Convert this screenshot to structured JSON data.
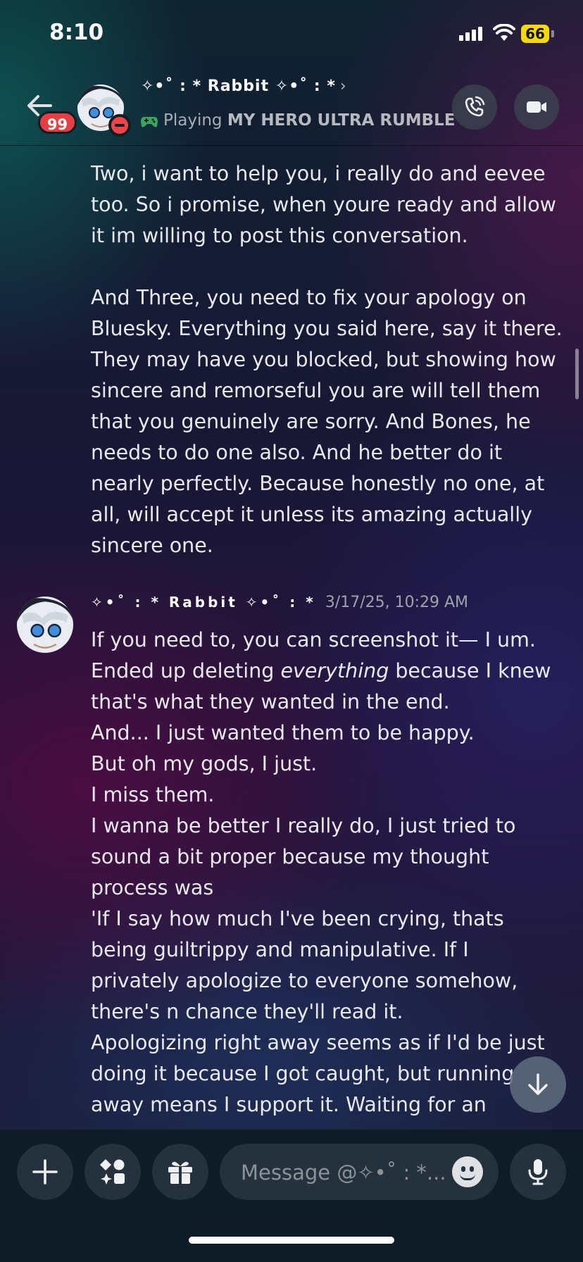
{
  "status_bar": {
    "time": "8:10",
    "battery": "66"
  },
  "header": {
    "unread_badge": "99",
    "display_name": "✧•˚ : * Rabbit ✧•˚ : *",
    "chevron": "›",
    "activity_prefix": "Playing",
    "activity_game": "MY HERO ULTRA RUMBLE"
  },
  "messages": {
    "previous_paragraphs": [
      "Two, i want to help you, i really do and eevee too. So i promise, when youre ready and allow it im willing to post this conversation.",
      "And Three, you need to fix your apology on Bluesky. Everything you said here, say it there. They may have you blocked, but showing how sincere and remorseful you are will tell them that you genuinely are sorry. And Bones, he needs to do one also. And he better do it nearly perfectly. Because honestly no one, at all, will accept it unless its amazing actually sincere one."
    ],
    "rabbit_message": {
      "author": "✧•˚ : * Rabbit ✧•˚ : *",
      "timestamp": "3/17/25, 10:29 AM",
      "line1": "If you need to, you can screenshot it— I um.",
      "line2_before": "Ended up deleting ",
      "line2_emphasis": "everything",
      "line2_after": " because I knew that's what they wanted in the end.",
      "line3": "And... I just wanted them to be happy.",
      "line4": "But oh my gods, I just.",
      "line5": "I miss them.",
      "line6": "I wanna be better I really do, I just tried to sound a bit proper because my thought process was",
      "line7": "'If I say how much I've been crying, thats being guiltrippy and manipulative. If I privately apologize to everyone somehow, there's n chance they'll read it.",
      "line8": "Apologizing right away seems as if I'd be just doing it because I got caught, but running away means I support it. Waiting for an"
    }
  },
  "composer": {
    "placeholder": "Message @✧•˚ : *..."
  },
  "colors": {
    "badge": "#e53f43",
    "dnd": "#f04346",
    "controller": "#3ba55d",
    "battery": "#f5d90a"
  },
  "icons": [
    "back-arrow-icon",
    "phone-call-icon",
    "video-camera-icon",
    "plus-icon",
    "apps-icon",
    "gift-icon",
    "emoji-icon",
    "microphone-icon",
    "arrow-down-icon",
    "controller-icon"
  ]
}
